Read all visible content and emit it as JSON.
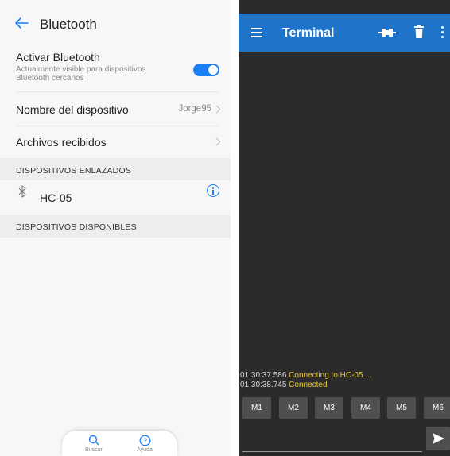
{
  "bluetooth": {
    "title": "Bluetooth",
    "activate": {
      "label": "Activar Bluetooth",
      "sub_line1": "Actualmente visible para dispositivos",
      "sub_line2": "Bluetooth cercanos",
      "enabled": true
    },
    "device_name": {
      "label": "Nombre del dispositivo",
      "value": "Jorge95"
    },
    "received_files": {
      "label": "Archivos recibidos"
    },
    "paired_header": "DISPOSITIVOS ENLAZADOS",
    "paired_devices": [
      {
        "name": "HC-05"
      }
    ],
    "available_header": "DISPOSITIVOS DISPONIBLES",
    "bottom_nav": {
      "search": "Buscar",
      "help": "Ayuda"
    },
    "accent_color": "#1a7ff2"
  },
  "terminal": {
    "title": "Terminal",
    "header_color": "#1f73c9",
    "log": [
      {
        "time": "01:30:37.586",
        "message": "Connecting to HC-05 ..."
      },
      {
        "time": "01:30:38.745",
        "message": "Connected"
      }
    ],
    "macro_buttons": [
      "M1",
      "M2",
      "M3",
      "M4",
      "M5",
      "M6"
    ],
    "message_color": "#e7c531"
  }
}
